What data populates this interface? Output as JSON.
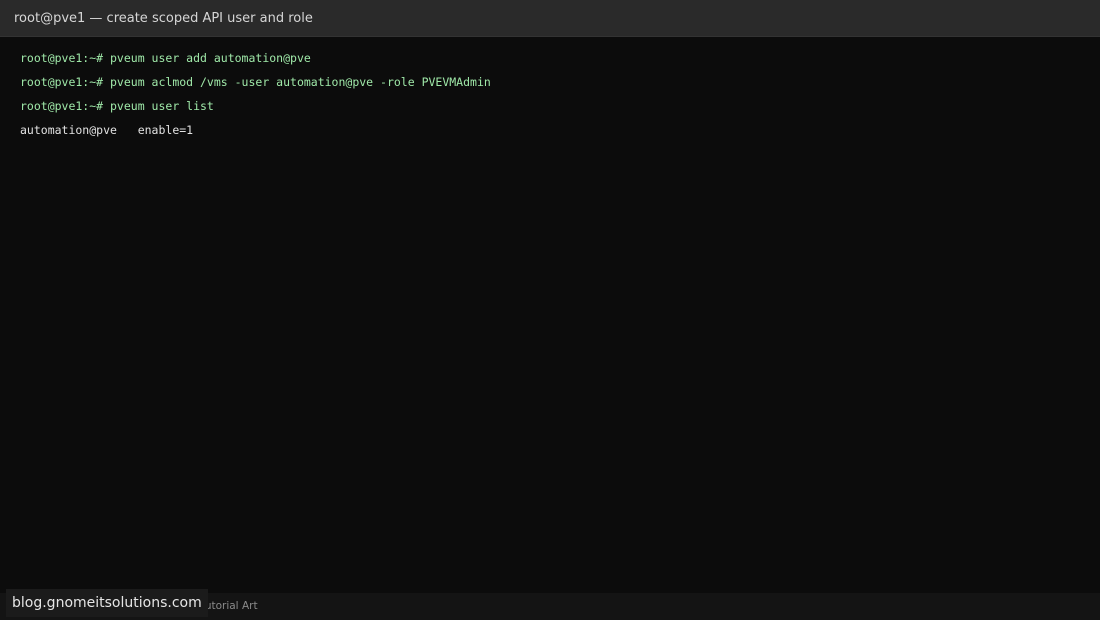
{
  "window": {
    "title": "root@pve1 — create scoped API user and role"
  },
  "terminal": {
    "lines": [
      {
        "text": "root@pve1:~# pveum user add automation@pve",
        "kind": "prompt"
      },
      {
        "text": "root@pve1:~# pveum aclmod /vms -user automation@pve -role PVEVMAdmin",
        "kind": "prompt"
      },
      {
        "text": "root@pve1:~# pveum user list",
        "kind": "prompt"
      },
      {
        "text": "automation@pve   enable=1",
        "kind": "output"
      }
    ]
  },
  "footer": {
    "caption": "Tutorial Art",
    "watermark": "blog.gnomeitsolutions.com"
  },
  "colors": {
    "title_bar": "#2a2a2a",
    "terminal_bg": "#0c0c0c",
    "prompt_text": "#9fe8a8",
    "output_text": "#e2e2e2"
  }
}
